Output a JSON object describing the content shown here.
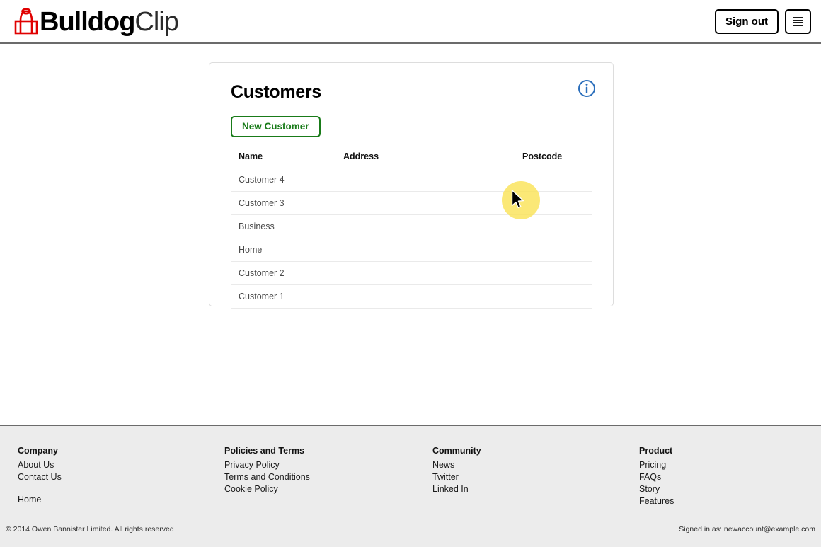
{
  "header": {
    "brand": {
      "bold": "Bulldog",
      "light": "Clip",
      "icon": "bulldog-clip-icon",
      "icon_color": "#e00000"
    },
    "sign_out_label": "Sign out",
    "menu_icon": "hamburger-menu-icon"
  },
  "card": {
    "title": "Customers",
    "info_icon": "info-circle-icon",
    "info_icon_color": "#2a6ebb",
    "new_customer_label": "New Customer",
    "new_customer_color": "#197b19",
    "table": {
      "columns": [
        "Name",
        "Address",
        "Postcode"
      ],
      "rows": [
        {
          "name": "Customer 4",
          "address": "",
          "postcode": ""
        },
        {
          "name": "Customer 3",
          "address": "",
          "postcode": ""
        },
        {
          "name": "Business",
          "address": "",
          "postcode": ""
        },
        {
          "name": "Home",
          "address": "",
          "postcode": ""
        },
        {
          "name": "Customer 2",
          "address": "",
          "postcode": ""
        },
        {
          "name": "Customer 1",
          "address": "",
          "postcode": ""
        }
      ]
    }
  },
  "cursor": {
    "name": "mouse-cursor",
    "highlight_color": "#fae150"
  },
  "footer": {
    "columns": [
      {
        "heading": "Company",
        "links": [
          "About Us",
          "Contact Us"
        ],
        "extra_links": [
          "Home"
        ]
      },
      {
        "heading": "Policies and Terms",
        "links": [
          "Privacy Policy",
          "Terms and Conditions",
          "Cookie Policy"
        ],
        "extra_links": []
      },
      {
        "heading": "Community",
        "links": [
          "News",
          "Twitter",
          "Linked In"
        ],
        "extra_links": []
      },
      {
        "heading": "Product",
        "links": [
          "Pricing",
          "FAQs",
          "Story",
          "Features"
        ],
        "extra_links": []
      }
    ],
    "copyright": "© 2014 Owen Bannister Limited. All rights reserved",
    "signed_in": "Signed in as: newaccount@example.com"
  }
}
